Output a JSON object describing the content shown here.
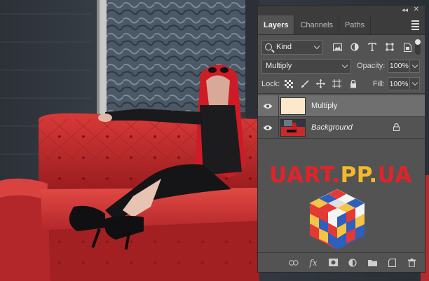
{
  "panel": {
    "tabs": [
      {
        "label": "Layers",
        "active": true
      },
      {
        "label": "Channels",
        "active": false
      },
      {
        "label": "Paths",
        "active": false
      }
    ],
    "filter": {
      "kind_label": "Kind"
    },
    "blend_mode": "Multiply",
    "opacity_label": "Opacity:",
    "opacity_value": "100%",
    "lock_label": "Lock:",
    "fill_label": "Fill:",
    "fill_value": "100%",
    "layers": [
      {
        "name": "Multiply",
        "selected": true,
        "visible": true,
        "thumb_color": "#fde8cc",
        "locked": false
      },
      {
        "name": "Background",
        "selected": false,
        "visible": true,
        "locked": true
      }
    ]
  },
  "watermark": {
    "text_part1": "UART.",
    "text_part2": "PP.",
    "text_part3": "UA"
  },
  "colors": {
    "panel_bg": "#535353",
    "selected_row": "#6f6f6f",
    "sofa_red": "#c4282a",
    "hair_red": "#d11a24"
  }
}
